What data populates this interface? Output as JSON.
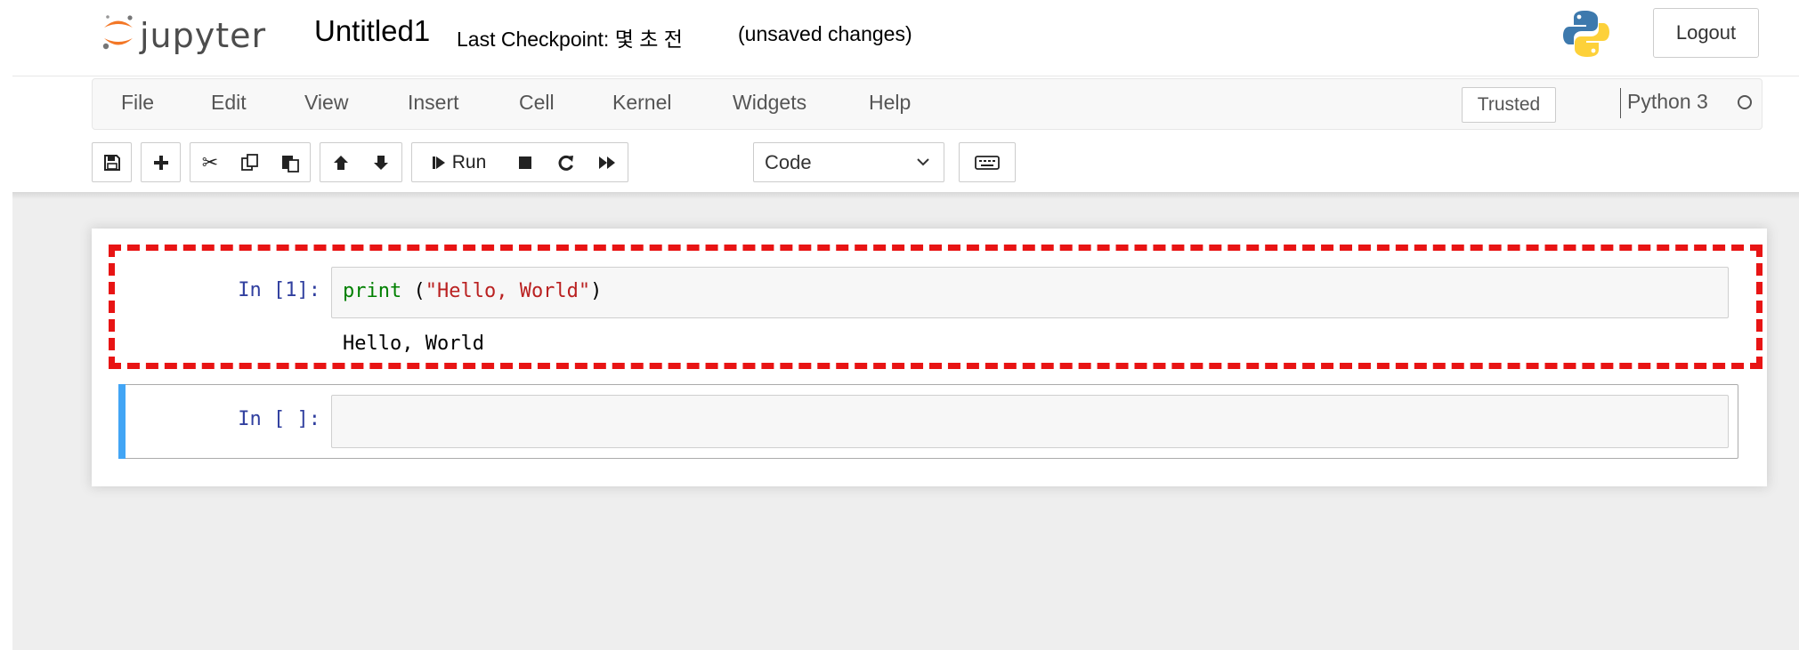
{
  "header": {
    "logo_text": "jupyter",
    "notebook_name": "Untitled1",
    "checkpoint_label": "Last Checkpoint: 몇 초 전",
    "autosave_status": "(unsaved changes)",
    "logout_label": "Logout"
  },
  "menubar": {
    "items": [
      "File",
      "Edit",
      "View",
      "Insert",
      "Cell",
      "Kernel",
      "Widgets",
      "Help"
    ],
    "trusted_label": "Trusted",
    "kernel_name": "Python 3"
  },
  "toolbar": {
    "run_label": "Run",
    "cell_type_selected": "Code",
    "buttons": [
      "save-icon",
      "plus-icon",
      "cut-icon",
      "copy-icon",
      "paste-icon",
      "arrow-up-icon",
      "arrow-down-icon",
      "run-icon",
      "stop-icon",
      "restart-icon",
      "fast-forward-icon",
      "keyboard-icon"
    ]
  },
  "cells": [
    {
      "prompt": "In [1]:",
      "code_func": "print",
      "code_open": " (",
      "code_string": "\"Hello, World\"",
      "code_close": ")",
      "output": "Hello, World"
    },
    {
      "prompt": "In [ ]:",
      "code": ""
    }
  ],
  "colors": {
    "prompt": "#303f9f",
    "keyword": "#008000",
    "string": "#ba2121",
    "selected_bar": "#42a5f5",
    "annotation": "#e81414"
  }
}
